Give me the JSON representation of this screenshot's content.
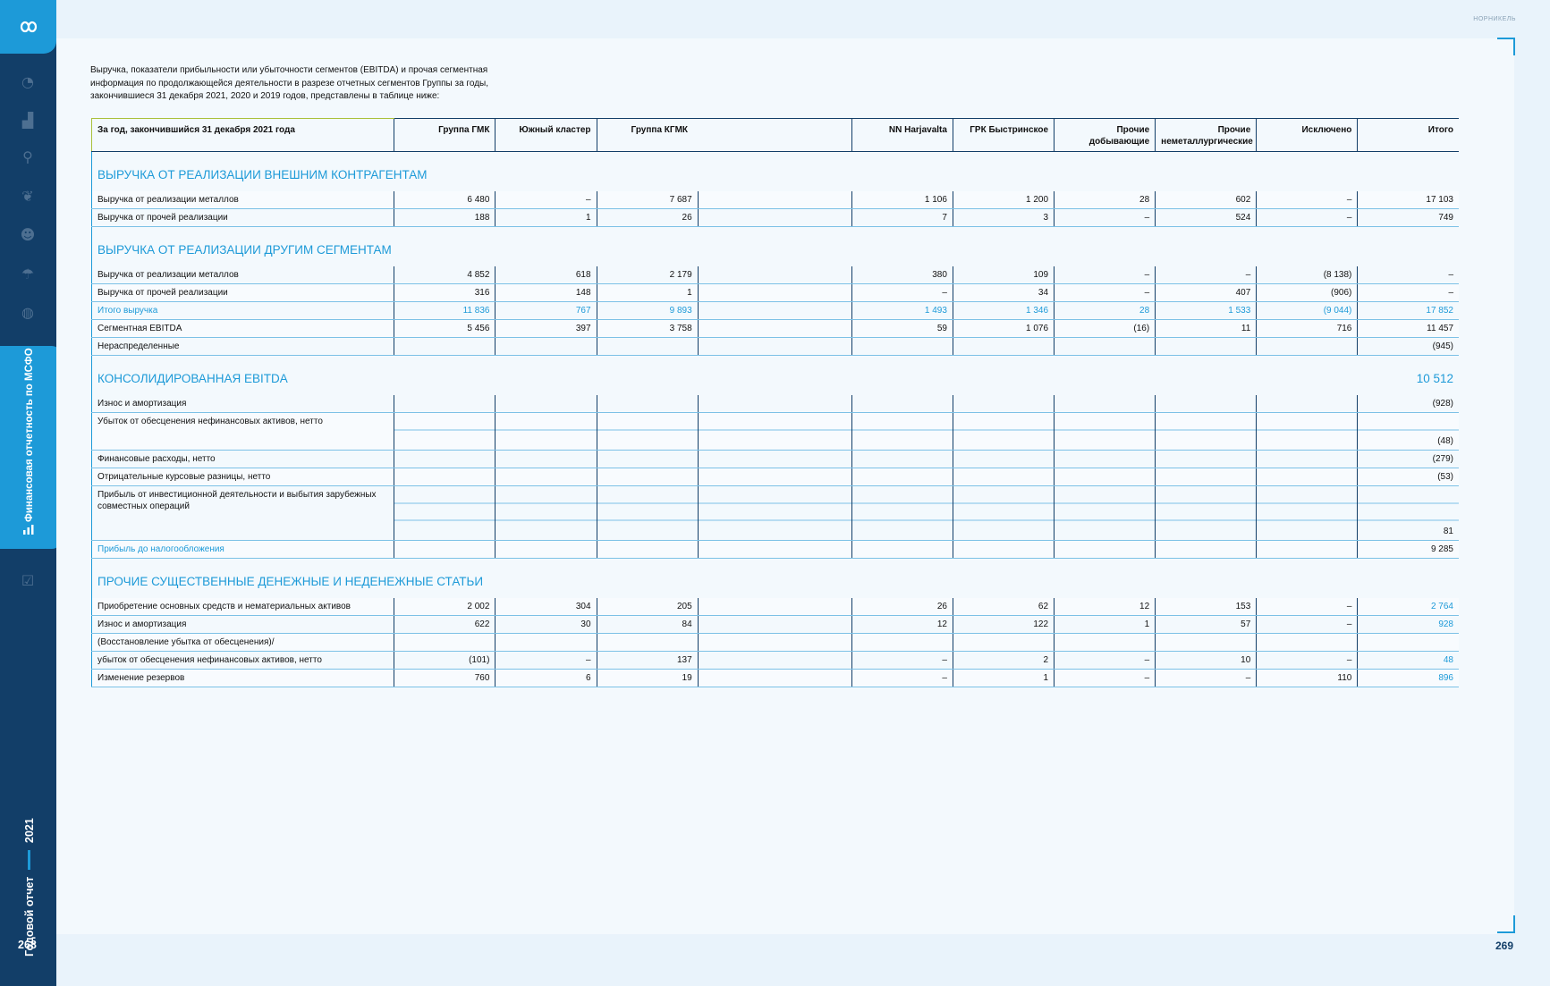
{
  "sidebar": {
    "active_section": "Финансовая отчетность по МСФО",
    "report_title": "Годовой отчет",
    "report_year": "2021",
    "page_left": "268",
    "icons": [
      "chart-pie-icon",
      "factory-icon",
      "search-icon",
      "leaf-icon",
      "people-icon",
      "umbrella-icon",
      "globe-icon",
      "checklist-icon"
    ]
  },
  "header": {
    "brand": "НОРНИКЕЛЬ",
    "page_right": "269"
  },
  "intro": "Выручка, показатели прибыльности или убыточности сегментов (EBITDA) и прочая сегментная информация по продолжающейся деятельности в разрезе отчетных сегментов Группы за годы, закончившиеся 31 декабря 2021, 2020 и 2019 годов, представлены в таблице ниже:",
  "table": {
    "columns": [
      "За год, закончившийся 31 декабря 2021 года",
      "Группа ГМК",
      "Южный кластер",
      "Группа КГМК",
      "",
      "NN Harjavalta",
      "ГРК Быстринское",
      "Прочие добывающие",
      "Прочие неметаллургические",
      "Исключено",
      "Итого"
    ],
    "sections": {
      "s1": "ВЫРУЧКА ОТ РЕАЛИЗАЦИИ ВНЕШНИМ КОНТРАГЕНТАМ",
      "s2": "ВЫРУЧКА ОТ РЕАЛИЗАЦИИ ДРУГИМ СЕГМЕНТАМ",
      "s3": "КОНСОЛИДИРОВАННАЯ EBITDA",
      "s3_total": "10 512",
      "s4": "ПРОЧИЕ СУЩЕСТВЕННЫЕ ДЕНЕЖНЫЕ И НЕДЕНЕЖНЫЕ СТАТЬИ"
    },
    "rows": {
      "r1": [
        "Выручка от реализации металлов",
        "6 480",
        "–",
        "7 687",
        "",
        "1 106",
        "1 200",
        "28",
        "602",
        "–",
        "17 103"
      ],
      "r2": [
        "Выручка от прочей реализации",
        "188",
        "1",
        "26",
        "",
        "7",
        "3",
        "–",
        "524",
        "–",
        "749"
      ],
      "r3": [
        "Выручка от реализации металлов",
        "4 852",
        "618",
        "2 179",
        "",
        "380",
        "109",
        "–",
        "–",
        "(8 138)",
        "–"
      ],
      "r4": [
        "Выручка от прочей реализации",
        "316",
        "148",
        "1",
        "",
        "–",
        "34",
        "–",
        "407",
        "(906)",
        "–"
      ],
      "r5": [
        "Итого выручка",
        "11 836",
        "767",
        "9 893",
        "",
        "1 493",
        "1 346",
        "28",
        "1 533",
        "(9 044)",
        "17 852"
      ],
      "r6": [
        "Сегментная EBITDA",
        "5 456",
        "397",
        "3 758",
        "",
        "59",
        "1 076",
        "(16)",
        "11",
        "716",
        "11 457"
      ],
      "r7": [
        "Нераспределенные",
        "",
        "",
        "",
        "",
        "",
        "",
        "",
        "",
        "",
        "(945)"
      ],
      "r8": [
        "Износ и амортизация",
        "",
        "",
        "",
        "",
        "",
        "",
        "",
        "",
        "",
        "(928)"
      ],
      "r9": [
        "Убыток от обесценения нефинансовых активов, нетто",
        "",
        "",
        "",
        "",
        "",
        "",
        "",
        "",
        "",
        "(48)"
      ],
      "r10": [
        "Финансовые расходы, нетто",
        "",
        "",
        "",
        "",
        "",
        "",
        "",
        "",
        "",
        "(279)"
      ],
      "r11": [
        "Отрицательные курсовые разницы, нетто",
        "",
        "",
        "",
        "",
        "",
        "",
        "",
        "",
        "",
        "(53)"
      ],
      "r12": [
        "Прибыль от инвестиционной деятельности и выбытия зарубежных совместных операций",
        "",
        "",
        "",
        "",
        "",
        "",
        "",
        "",
        "",
        "81"
      ],
      "r13": [
        "Прибыль до налогообложения",
        "",
        "",
        "",
        "",
        "",
        "",
        "",
        "",
        "",
        "9 285"
      ],
      "r14": [
        "Приобретение основных средств и нематериальных активов",
        "2 002",
        "304",
        "205",
        "",
        "26",
        "62",
        "12",
        "153",
        "–",
        "2 764"
      ],
      "r15": [
        "Износ и амортизация",
        "622",
        "30",
        "84",
        "",
        "12",
        "122",
        "1",
        "57",
        "–",
        "928"
      ],
      "r16": [
        "(Восстановление убытка от обесценения)/",
        "",
        "",
        "",
        "",
        "",
        "",
        "",
        "",
        "",
        ""
      ],
      "r17": [
        "убыток от обесценения нефинансовых активов, нетто",
        "(101)",
        "–",
        "137",
        "",
        "–",
        "2",
        "–",
        "10",
        "–",
        "48"
      ],
      "r18": [
        "Изменение резервов",
        "760",
        "6",
        "19",
        "",
        "–",
        "1",
        "–",
        "–",
        "110",
        "896"
      ]
    }
  },
  "colors": {
    "accent": "#1d9ad8",
    "navy": "#123e68",
    "lime": "#a9c03a"
  }
}
